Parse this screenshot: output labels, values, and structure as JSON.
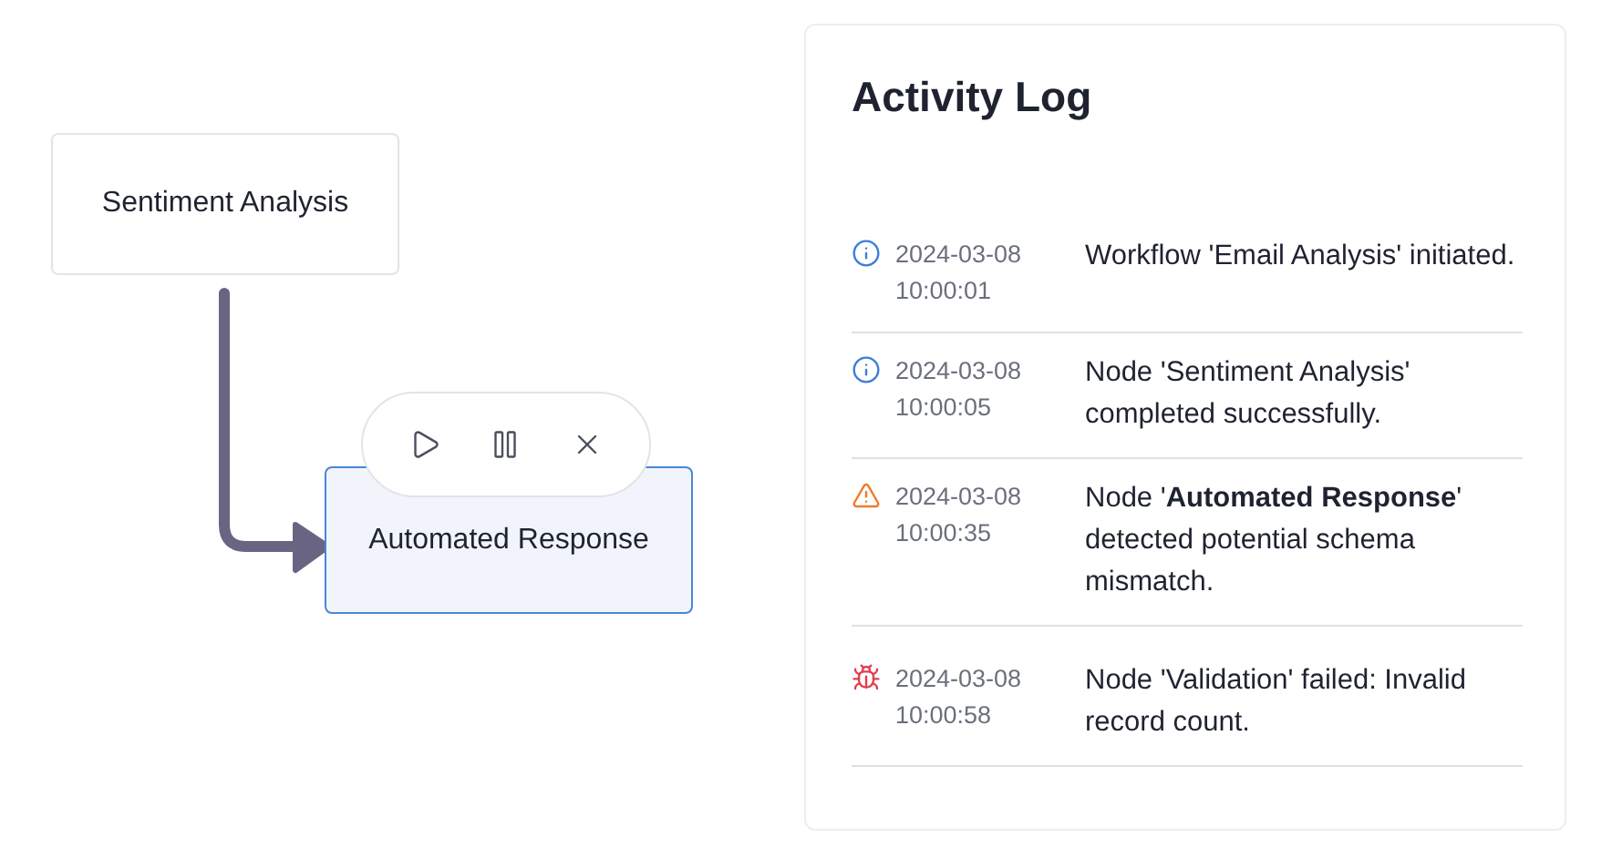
{
  "canvas": {
    "nodes": [
      {
        "label": "Sentiment Analysis",
        "selected": false
      },
      {
        "label": "Automated Response",
        "selected": true
      }
    ],
    "node_toolbar": {
      "buttons": [
        {
          "kind": "play"
        },
        {
          "kind": "pause"
        },
        {
          "kind": "close"
        }
      ]
    }
  },
  "activity_log": {
    "title": "Activity Log",
    "entries": [
      {
        "kind": "info",
        "date": "2024-03-08",
        "time": "10:00:01",
        "message": "Workflow 'Email Analysis' initiated."
      },
      {
        "kind": "info",
        "date": "2024-03-08",
        "time": "10:00:05",
        "message": "Node 'Sentiment Analysis' completed successfully."
      },
      {
        "kind": "warning",
        "date": "2024-03-08",
        "time": "10:00:35",
        "message": "Node '**Automated Response**' detected potential schema mismatch."
      },
      {
        "kind": "error",
        "date": "2024-03-08",
        "time": "10:00:58",
        "message": "Node 'Validation' failed: Invalid record count."
      }
    ]
  }
}
